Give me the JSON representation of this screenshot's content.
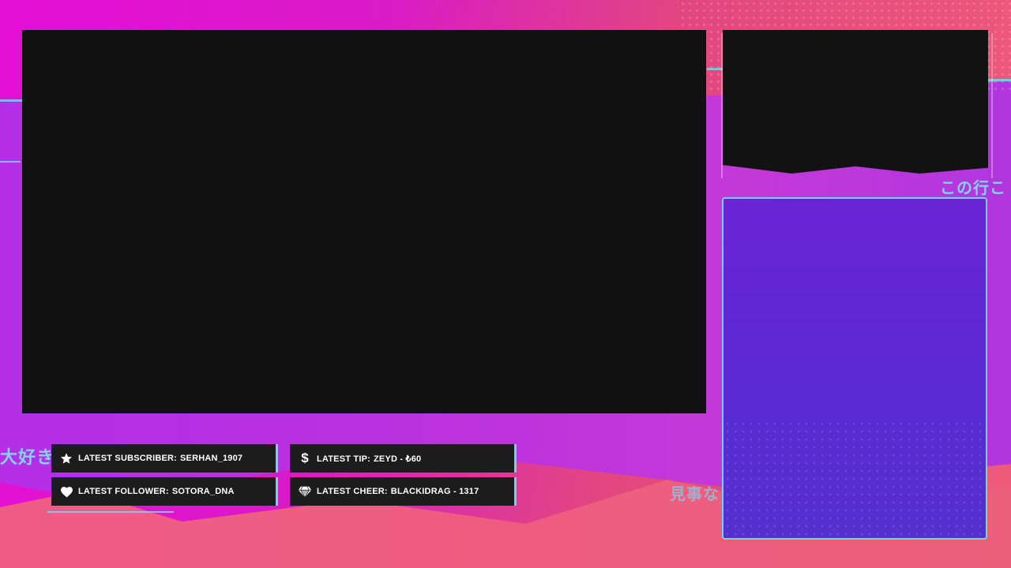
{
  "overlay": {
    "stats": {
      "subscriber": {
        "label": "LATEST SUBSCRIBER:",
        "value": "SERHAN_1907"
      },
      "follower": {
        "label": "LATEST FOLLOWER:",
        "value": "SOTORA_DNA"
      },
      "tip": {
        "label": "LATEST TIP:",
        "value": "ZEYD - ₺60"
      },
      "cheer": {
        "label": "LATEST CHEER:",
        "value": "BLACKIDRAG - 1317"
      }
    },
    "decor_text": {
      "left": "大好き",
      "right_top": "この行こ",
      "right_mid": "見事な"
    },
    "icons": {
      "subscriber": "star-icon",
      "follower": "heart-icon",
      "tip": "dollar-icon",
      "cheer": "diamond-icon"
    },
    "colors": {
      "accent_cyan": "#6fd2ee",
      "panel_dark": "#1c1c1c",
      "screen_black": "#111111",
      "magenta": "#e50fd6",
      "violet": "#6a24d6",
      "coral": "#ef5d86"
    }
  }
}
